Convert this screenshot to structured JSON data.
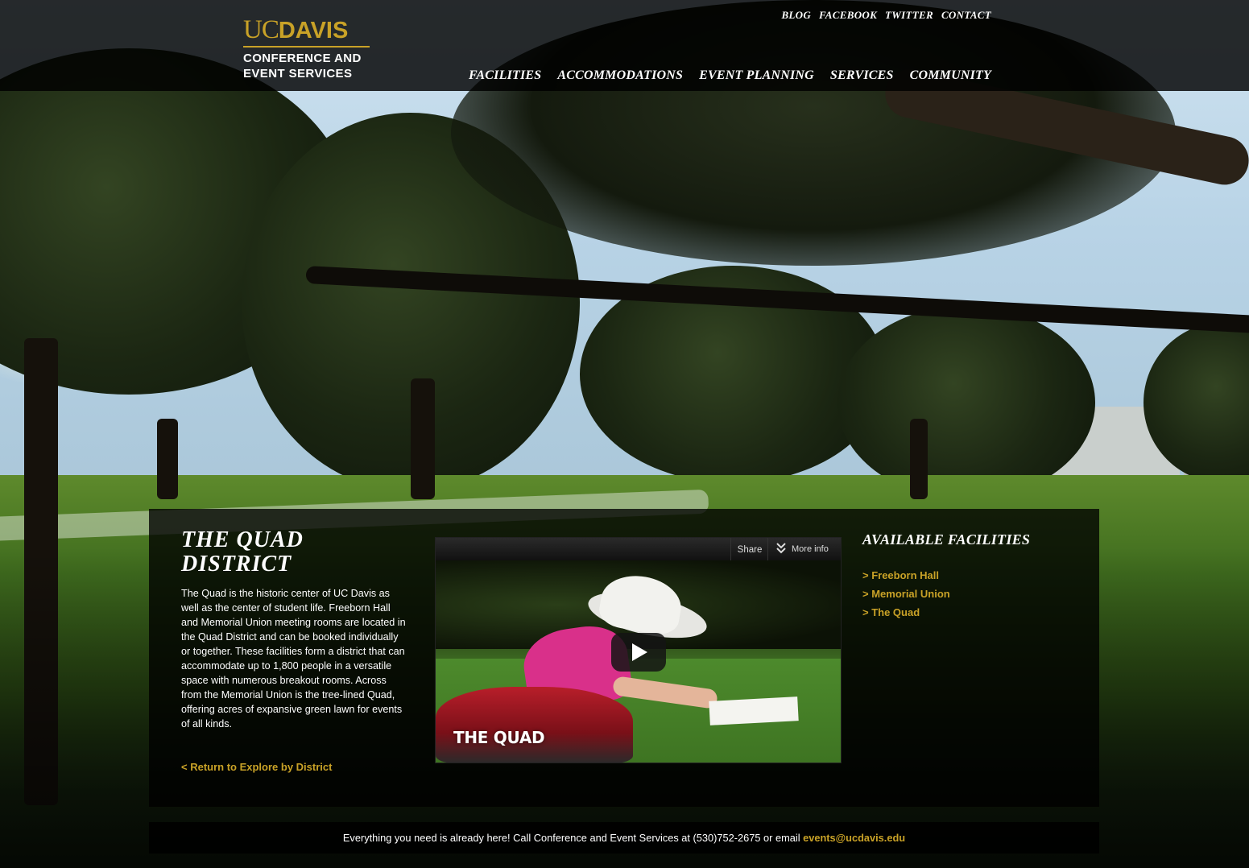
{
  "brand": {
    "uc": "UC",
    "davis": "DAVIS",
    "line1": "CONFERENCE AND",
    "line2": "EVENT SERVICES",
    "gold": "#c9a227"
  },
  "top_nav": [
    "BLOG",
    "FACEBOOK",
    "TWITTER",
    "CONTACT"
  ],
  "main_nav": [
    "FACILITIES",
    "ACCOMMODATIONS",
    "EVENT PLANNING",
    "SERVICES",
    "COMMUNITY"
  ],
  "district": {
    "title_line1": "THE QUAD",
    "title_line2": "DISTRICT",
    "description": "The Quad is the historic center of UC Davis as well as the center of student life. Freeborn Hall and Memorial Union meeting rooms are located in the Quad District and can be booked individually or together. These facilities form a district that can accommodate up to 1,800 people in a versatile space with numerous breakout rooms. Across from the Memorial Union is the tree-lined Quad, offering acres of expansive green lawn for events of all kinds.",
    "return_link": "< Return to Explore by District"
  },
  "video": {
    "share_label": "Share",
    "more_info_label": "More info",
    "caption": "THE QUAD",
    "play_icon": "play-icon",
    "more_info_icon": "chevron-down-icon"
  },
  "facilities": {
    "title": "AVAILABLE FACILITIES",
    "items": [
      "> Freeborn Hall",
      "> Memorial Union",
      "> The Quad"
    ]
  },
  "footer": {
    "text": "Everything you need is already here! Call Conference and Event Services at (530)752-2675 or email ",
    "email": "events@ucdavis.edu"
  }
}
